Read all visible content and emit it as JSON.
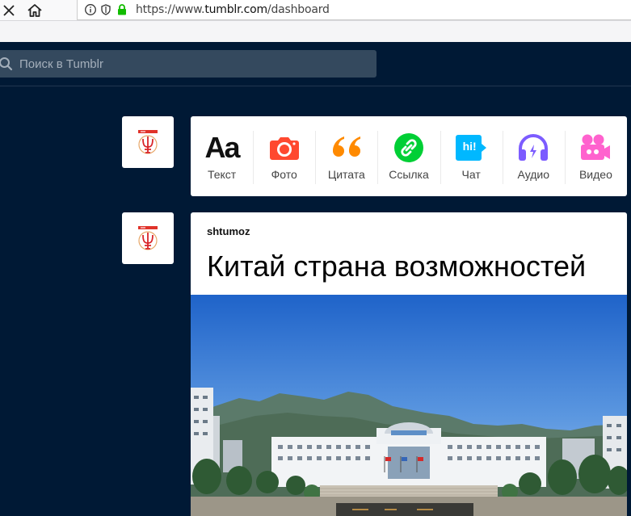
{
  "browser": {
    "url_prefix": "https://www.",
    "url_domain": "tumblr.com",
    "url_path": "/dashboard"
  },
  "search": {
    "placeholder": "Поиск в Tumblr"
  },
  "post_types": [
    {
      "label": "Текст",
      "icon": "text-icon",
      "color": "#111111"
    },
    {
      "label": "Фото",
      "icon": "camera-icon",
      "color": "#ff492f"
    },
    {
      "label": "Цитата",
      "icon": "quote-icon",
      "color": "#ff8a00"
    },
    {
      "label": "Ссылка",
      "icon": "link-icon",
      "color": "#00cf35"
    },
    {
      "label": "Чат",
      "icon": "chat-icon",
      "color": "#00b8ff"
    },
    {
      "label": "Аудио",
      "icon": "headphones-icon",
      "color": "#7c5cff"
    },
    {
      "label": "Видео",
      "icon": "video-camera-icon",
      "color": "#ff62ce"
    }
  ],
  "text_icon_glyph": "Aa",
  "chat_icon_glyph": "hi!",
  "post": {
    "blog_name": "shtumoz",
    "title": "Китай страна возможностей"
  },
  "colors": {
    "dashboard_bg": "#001935",
    "search_bg": "#34495e"
  }
}
